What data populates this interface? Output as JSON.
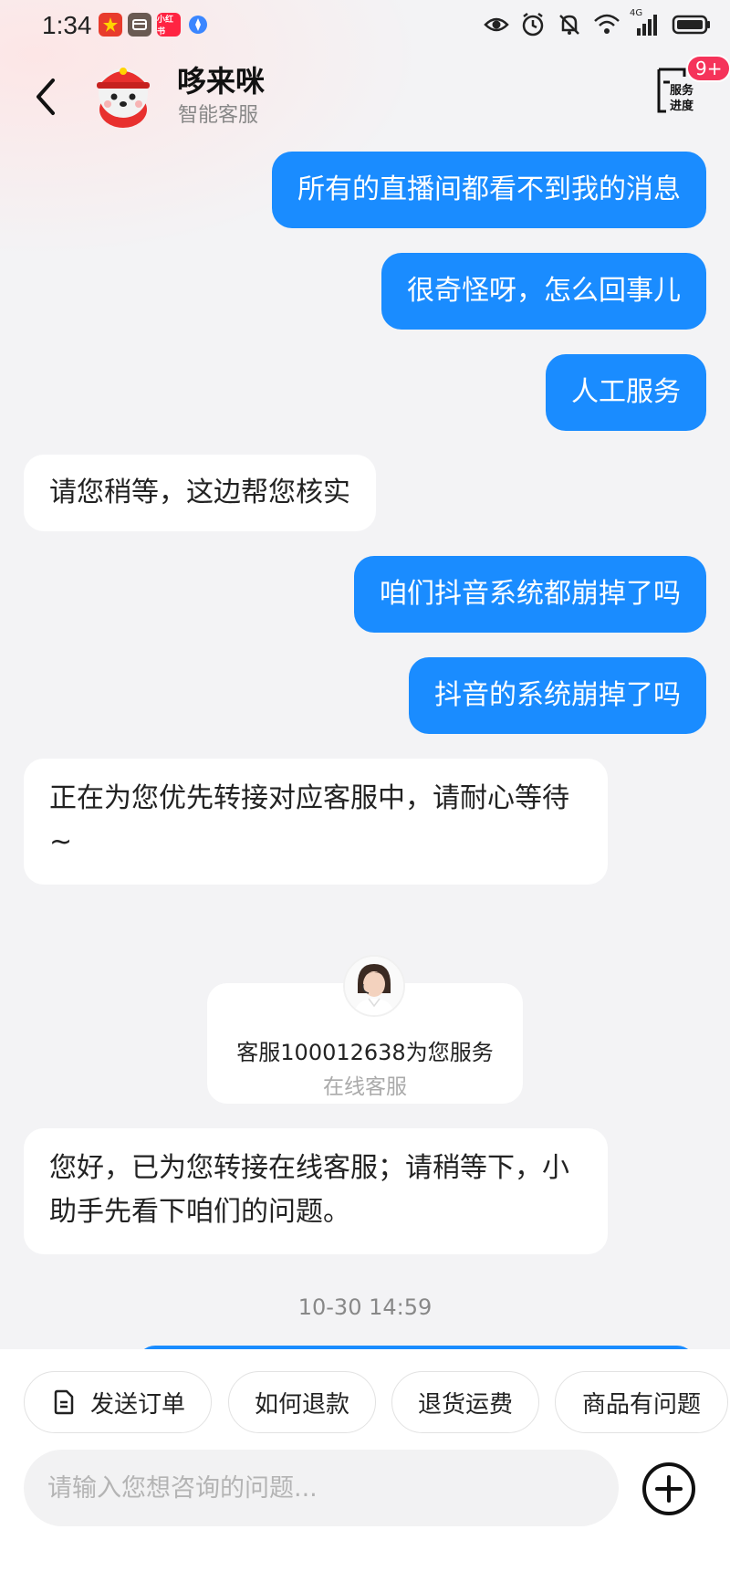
{
  "status_bar": {
    "time": "1:34",
    "network": "4G",
    "notif_icons": [
      "flag-icon",
      "wallet-icon",
      "xiaohongshu-icon",
      "compass-icon"
    ],
    "xiaohongshu_label": "小红书",
    "right_icons": [
      "eye-icon",
      "alarm-icon",
      "mute-icon",
      "wifi-icon",
      "signal-icon",
      "battery-icon"
    ]
  },
  "header": {
    "back_icon": "chevron-left-icon",
    "name": "哆来咪",
    "subtitle": "智能客服",
    "progress_label_top": "服务",
    "progress_label_bottom": "进度",
    "progress_badge": "9+"
  },
  "messages": [
    {
      "from": "user",
      "text": "所有的直播间都看不到我的消息"
    },
    {
      "from": "user",
      "text": "很奇怪呀，怎么回事儿"
    },
    {
      "from": "user",
      "text": "人工服务"
    },
    {
      "from": "bot",
      "text": "请您稍等，这边帮您核实"
    },
    {
      "from": "user",
      "text": "咱们抖音系统都崩掉了吗"
    },
    {
      "from": "user",
      "text": "抖音的系统崩掉了吗"
    },
    {
      "from": "bot",
      "text": "正在为您优先转接对应客服中，请耐心等待 ~"
    },
    {
      "from": "bot",
      "text": "您好，已为您转接在线客服；请稍等下，小助手先看下咱们的问题。"
    }
  ],
  "agent_card": {
    "title": "客服100012638为您服务",
    "subtitle": "在线客服"
  },
  "timestamp": "10-30 14:59",
  "quick_actions": [
    {
      "label": "发送订单",
      "icon": "document-icon"
    },
    {
      "label": "如何退款"
    },
    {
      "label": "退货运费"
    },
    {
      "label": "商品有问题"
    }
  ],
  "input": {
    "placeholder": "请输入您想咨询的问题..."
  },
  "colors": {
    "accent": "#1a8cff",
    "badge": "#f5335a",
    "background": "#f3f3f5"
  }
}
